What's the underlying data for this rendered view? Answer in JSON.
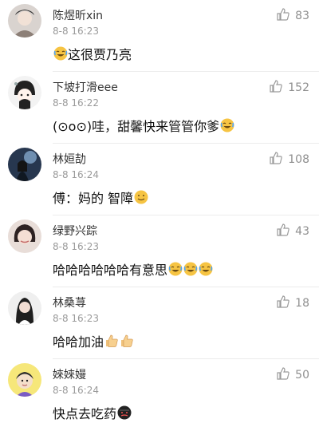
{
  "comments": [
    {
      "name": "陈煜昕xin",
      "time": "8-8 16:23",
      "text": "这很贾乃亮",
      "likes": "83",
      "emojis_before": [
        "laugh-cry-emoji"
      ],
      "emojis_after": []
    },
    {
      "name": "下坡打滑eee",
      "time": "8-8 16:22",
      "text": "(⊙o⊙)哇，甜馨快来管管你爹",
      "likes": "152",
      "emojis_before": [],
      "emojis_after": [
        "laugh-cry-emoji"
      ]
    },
    {
      "name": "林姮劼",
      "time": "8-8 16:24",
      "text": "傅：妈的 智障",
      "likes": "108",
      "emojis_before": [],
      "emojis_after": [
        "smile-emoji"
      ]
    },
    {
      "name": "绿野兴踪",
      "time": "8-8 16:23",
      "text": "哈哈哈哈哈哈有意思",
      "likes": "43",
      "emojis_before": [],
      "emojis_after": [
        "laugh-cry-emoji",
        "laugh-cry-emoji",
        "laugh-cry-emoji"
      ]
    },
    {
      "name": "林桑荨",
      "time": "8-8 16:23",
      "text": "哈哈加油",
      "likes": "18",
      "emojis_before": [],
      "emojis_after": [
        "thumbs-up-emoji",
        "thumbs-up-emoji"
      ]
    },
    {
      "name": "婡婡嫚",
      "time": "8-8 16:24",
      "text": "快点去吃药",
      "likes": "50",
      "emojis_before": [],
      "emojis_after": [
        "angry-emoji"
      ]
    }
  ]
}
